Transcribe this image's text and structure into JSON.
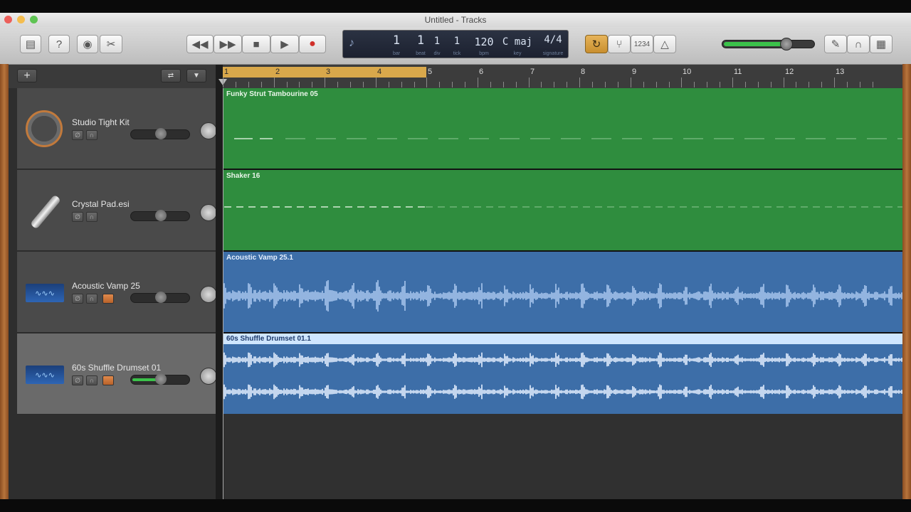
{
  "window": {
    "title": "Untitled - Tracks"
  },
  "toolbar": {
    "left_icons": [
      "library-icon",
      "help-icon",
      "smart-controls-icon",
      "editors-icon"
    ],
    "transport": [
      "rewind-icon",
      "fast-forward-icon",
      "stop-icon",
      "play-icon",
      "record-icon"
    ],
    "lcd": {
      "bar": "1",
      "beat": "1",
      "div": "1",
      "tick": "1",
      "bpm": "120",
      "key": "C maj",
      "signature": "4/4",
      "labels": {
        "bar": "bar",
        "beat": "beat",
        "div": "div",
        "tick": "tick",
        "bpm": "bpm",
        "key": "key",
        "signature": "signature"
      }
    },
    "count_in": "1234",
    "master_volume": 0.72,
    "accent_color": "#d9a84b"
  },
  "ruler": {
    "bars": [
      "1",
      "2",
      "3",
      "4",
      "5",
      "6",
      "7",
      "8",
      "9",
      "10",
      "11",
      "12",
      "13"
    ]
  },
  "tracks": [
    {
      "name": "Studio Tight Kit",
      "icon": "tambourine-icon",
      "volume": 0.5,
      "region": "Funky Strut Tambourine 05",
      "color": "#2e8b3c"
    },
    {
      "name": "Crystal Pad.esi",
      "icon": "shaker-icon",
      "volume": 0.5,
      "region": "Shaker 16",
      "color": "#2e8b3c"
    },
    {
      "name": "Acoustic Vamp 25",
      "icon": "waveform-icon",
      "volume": 0.5,
      "region": "Acoustic Vamp 25.1",
      "color": "#3d6ea8"
    },
    {
      "name": "60s Shuffle Drumset 01",
      "icon": "waveform-icon",
      "volume": 0.5,
      "region": "60s Shuffle Drumset 01.1",
      "color": "#3d6ea8"
    }
  ]
}
